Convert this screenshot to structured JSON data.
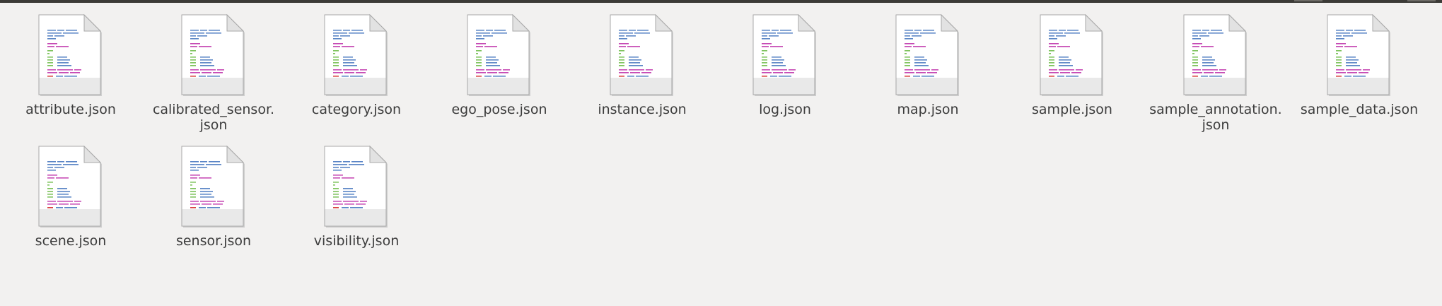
{
  "window": {
    "accent": "#3c3b37",
    "background": "#f2f1f0"
  },
  "files": [
    {
      "name_line1": "attribute.json",
      "name_line2": "",
      "icon": "json-file-icon"
    },
    {
      "name_line1": "calibrated_sensor.",
      "name_line2": "json",
      "icon": "json-file-icon"
    },
    {
      "name_line1": "category.json",
      "name_line2": "",
      "icon": "json-file-icon"
    },
    {
      "name_line1": "ego_pose.json",
      "name_line2": "",
      "icon": "json-file-icon"
    },
    {
      "name_line1": "instance.json",
      "name_line2": "",
      "icon": "json-file-icon"
    },
    {
      "name_line1": "log.json",
      "name_line2": "",
      "icon": "json-file-icon"
    },
    {
      "name_line1": "map.json",
      "name_line2": "",
      "icon": "json-file-icon"
    },
    {
      "name_line1": "sample.json",
      "name_line2": "",
      "icon": "json-file-icon"
    },
    {
      "name_line1": "sample_annotation.",
      "name_line2": "json",
      "icon": "json-file-icon"
    },
    {
      "name_line1": "sample_data.json",
      "name_line2": "",
      "icon": "json-file-icon"
    },
    {
      "name_line1": "scene.json",
      "name_line2": "",
      "icon": "json-file-icon"
    },
    {
      "name_line1": "sensor.json",
      "name_line2": "",
      "icon": "json-file-icon"
    },
    {
      "name_line1": "visibility.json",
      "name_line2": "",
      "icon": "json-file-icon"
    }
  ]
}
